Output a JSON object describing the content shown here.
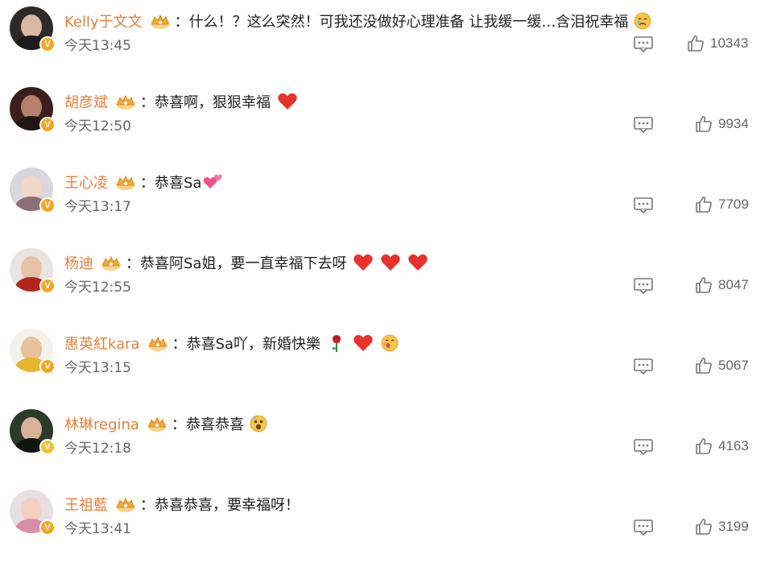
{
  "colors": {
    "username": "#e87f3c",
    "text": "#222222",
    "meta": "#666666",
    "verified_orange": "#f5a623",
    "verified_yellow": "#f2c230",
    "heart": "#e8322b"
  },
  "comments": [
    {
      "user": "Kelly于文文",
      "separator": "：",
      "text": "什么！？这么突然！可我还没做好心理准备 让我缓一缓…含泪祝幸福",
      "emojis": [
        "crying-face"
      ],
      "time": "今天13:45",
      "likes": "10343",
      "verified": "orange"
    },
    {
      "user": "胡彦斌",
      "separator": "：",
      "text": "恭喜啊，狠狠幸福",
      "emojis": [
        "red-heart"
      ],
      "time": "今天12:50",
      "likes": "9934",
      "verified": "orange"
    },
    {
      "user": "王心凌",
      "separator": "：",
      "text": "恭喜Sa",
      "emojis": [
        "two-hearts"
      ],
      "time": "今天13:17",
      "likes": "7709",
      "verified": "orange"
    },
    {
      "user": "杨迪",
      "separator": "：",
      "text": "恭喜阿Sa姐，要一直幸福下去呀",
      "emojis": [
        "red-heart",
        "red-heart",
        "red-heart"
      ],
      "time": "今天12:55",
      "likes": "8047",
      "verified": "orange"
    },
    {
      "user": "惠英紅kara",
      "separator": "：",
      "text": "恭喜Sa吖，新婚快樂",
      "emojis": [
        "rose",
        "red-heart",
        "kissing-face"
      ],
      "time": "今天13:15",
      "likes": "5067",
      "verified": "orange"
    },
    {
      "user": "林琳regina",
      "separator": "：",
      "text": "恭喜恭喜",
      "emojis": [
        "surprised-face"
      ],
      "time": "今天12:18",
      "likes": "4163",
      "verified": "yellow"
    },
    {
      "user": "王祖藍",
      "separator": "：",
      "text": "恭喜恭喜，要幸福呀！",
      "emojis": [],
      "time": "今天13:41",
      "likes": "3199",
      "verified": "orange"
    }
  ],
  "icons": {
    "crown": "vip-crown-icon",
    "reply": "comment-reply-icon",
    "like": "thumbs-up-icon",
    "verified": "verified-v-icon"
  }
}
